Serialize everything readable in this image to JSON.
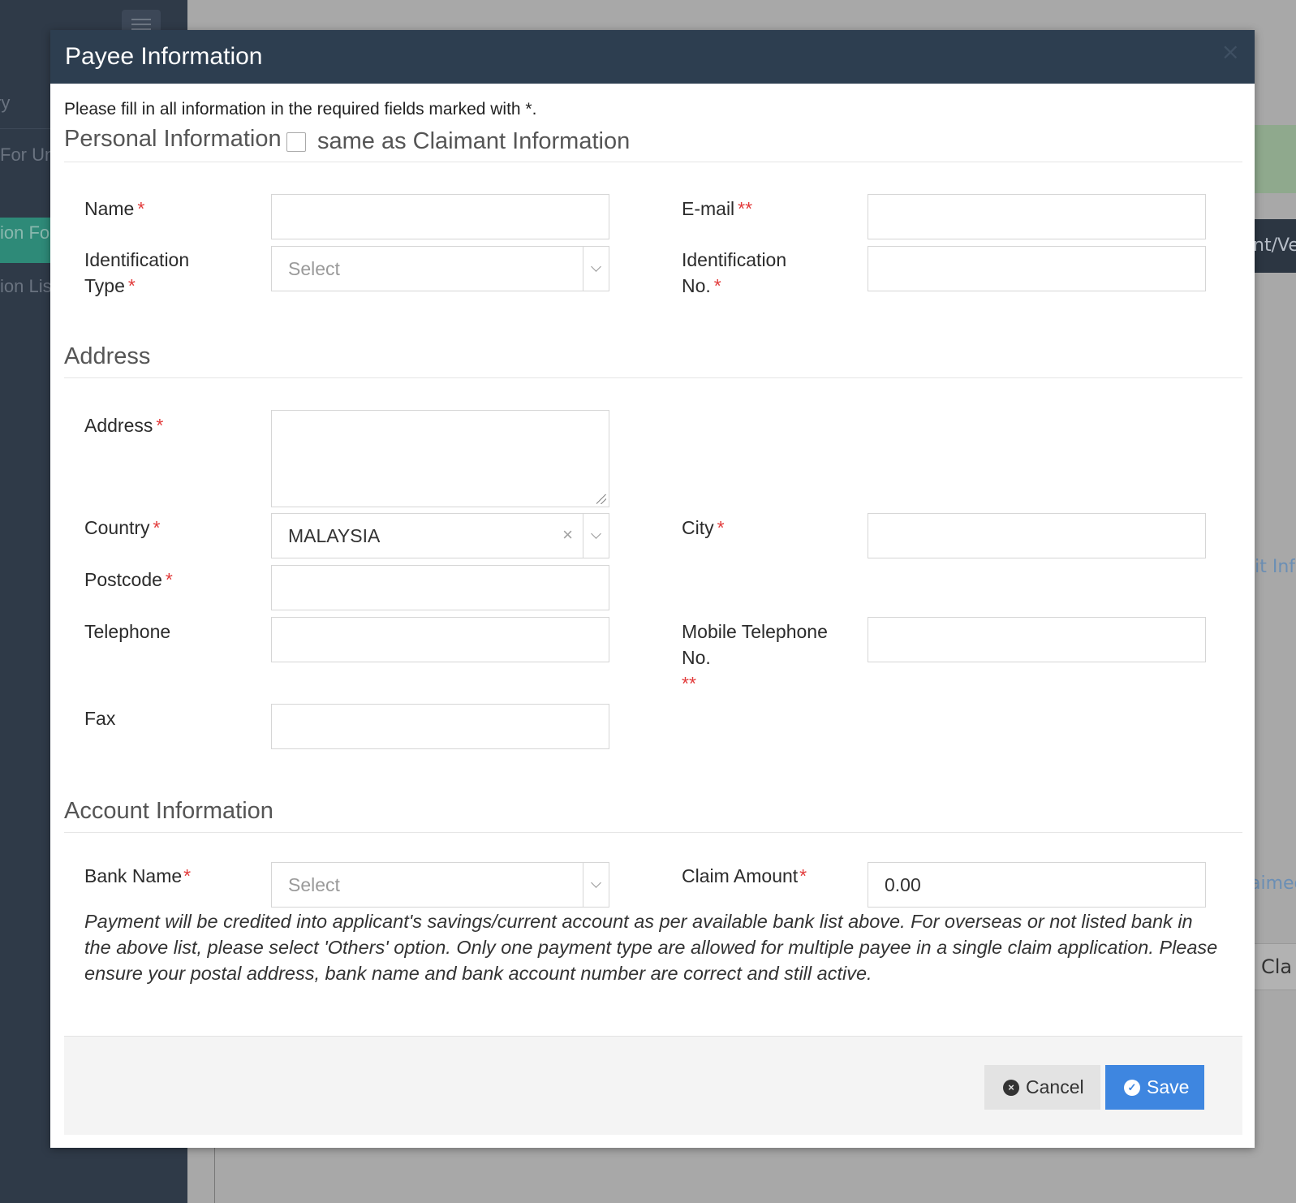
{
  "background": {
    "sidebar_items": [
      "ry",
      "For Un",
      "ion Fo",
      "ion Lis"
    ],
    "right_tab": "nt/Ver",
    "right_link_1": "lit Inf",
    "right_link_2": "aimed",
    "right_cell": "Cla"
  },
  "modal": {
    "title": "Payee Information",
    "close": "×",
    "hint": "Please fill in all information in the required fields marked with *.",
    "personal": {
      "section_title": "Personal Information",
      "same_as_label": "same as Claimant Information",
      "name_label": "Name",
      "name_req": "*",
      "name_value": "",
      "email_label": "E-mail",
      "email_req": "**",
      "email_value": "",
      "id_type_label": "Identification Type",
      "id_type_req": "*",
      "id_type_placeholder": "Select",
      "id_no_label": "Identification No.",
      "id_no_req": "*",
      "id_no_value": ""
    },
    "address": {
      "section_title": "Address",
      "address_label": "Address",
      "address_req": "*",
      "country_label": "Country",
      "country_req": "*",
      "country_value": "MALAYSIA",
      "country_clear": "×",
      "city_label": "City",
      "city_req": "*",
      "postcode_label": "Postcode",
      "postcode_req": "*",
      "telephone_label": "Telephone",
      "mobile_label": "Mobile Telephone No.",
      "mobile_req": "**",
      "fax_label": "Fax"
    },
    "account": {
      "section_title": "Account Information",
      "bank_label": "Bank Name",
      "bank_req": "*",
      "bank_placeholder": "Select",
      "amount_label": "Claim Amount",
      "amount_req": "*",
      "amount_value": "0.00",
      "note": "Payment will be credited into applicant's savings/current account as per available bank list above. For overseas or not listed bank in the above list, please select 'Others' option. Only one payment type are allowed for multiple payee in a single claim application. Please ensure your postal address, bank name and bank account number are correct and still active."
    },
    "footer": {
      "cancel_label": "Cancel",
      "cancel_icon": "×",
      "save_label": "Save",
      "save_icon": "✓"
    }
  },
  "colors": {
    "header_bg": "#2d3e50",
    "required": "#e23b3b",
    "save_button": "#3e86e0",
    "cancel_button": "#e3e3e3"
  }
}
